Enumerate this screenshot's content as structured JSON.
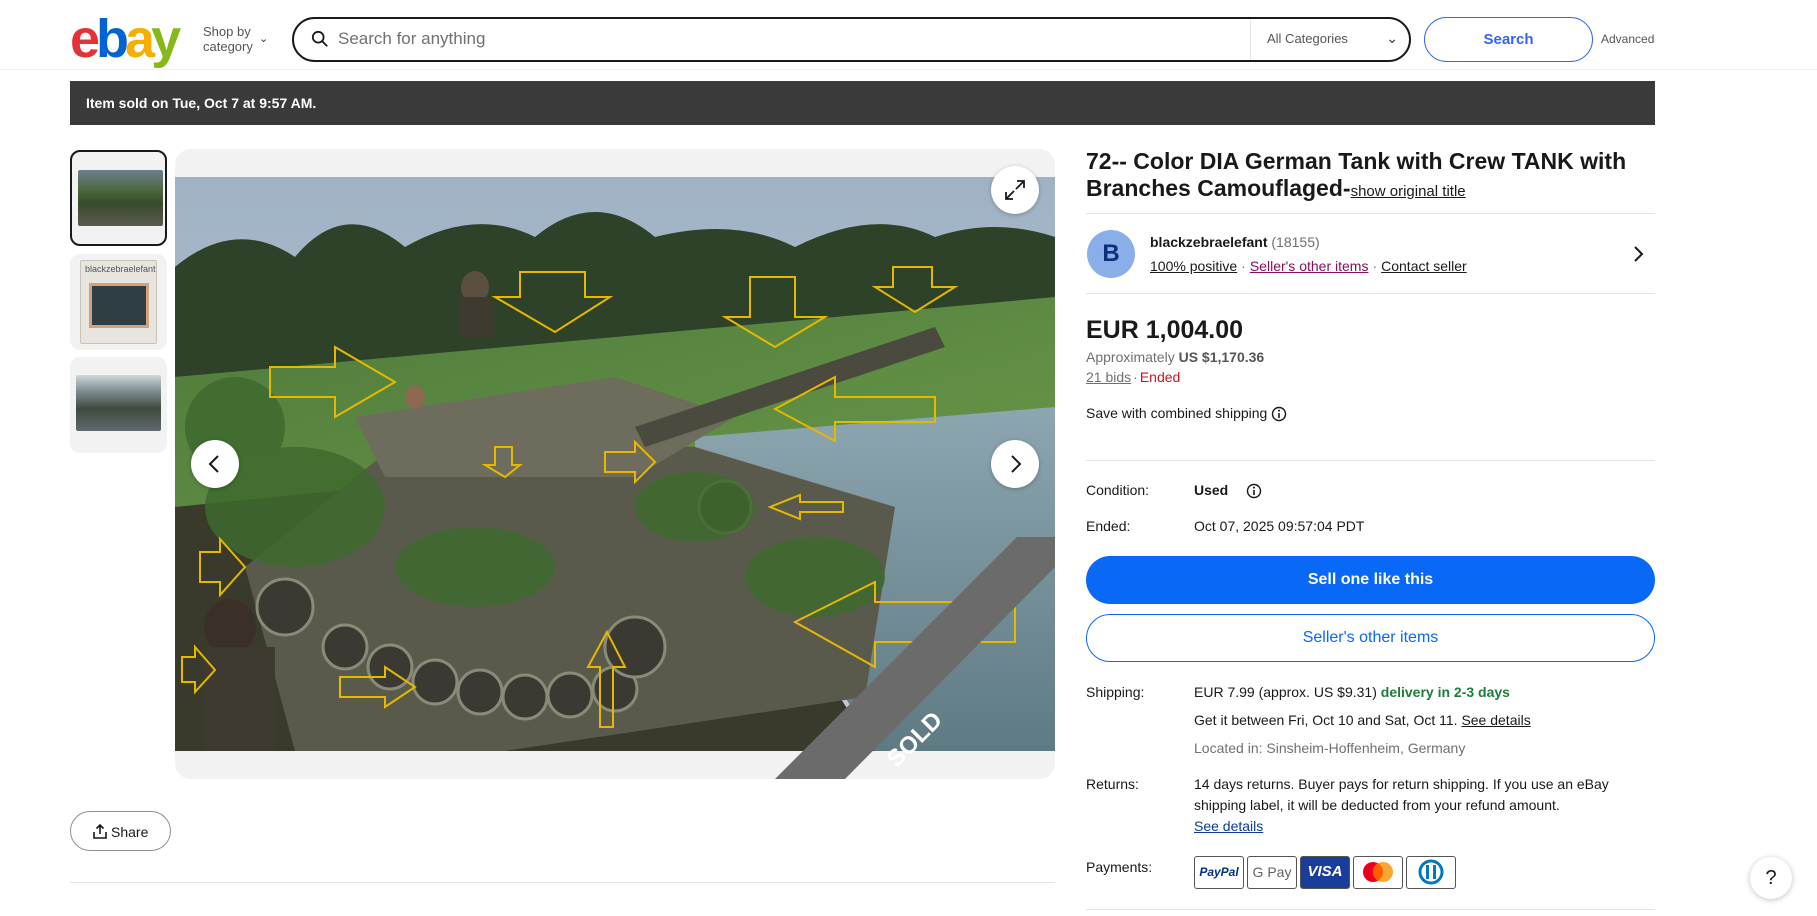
{
  "header": {
    "logo_letters": [
      "e",
      "b",
      "a",
      "y"
    ],
    "logo_colors": [
      "#e53238",
      "#0064d2",
      "#f5af02",
      "#86b817"
    ],
    "shop_by_line1": "Shop by",
    "shop_by_line2": "category",
    "search_placeholder": "Search for anything",
    "category_selected": "All Categories",
    "search_button": "Search",
    "advanced_link": "Advanced"
  },
  "banner": {
    "text": "Item sold on Tue, Oct 7 at 9:57 AM."
  },
  "gallery": {
    "thumb2_label": "blackzebraelefant",
    "sold_ribbon": "SOLD",
    "share_label": "Share"
  },
  "listing": {
    "title": "72-- Color DIA German Tank with Crew TANK with Branches Camouflaged-",
    "show_original_title": "show original title",
    "seller": {
      "initial": "B",
      "name": "blackzebraelefant",
      "feedback_count": "(18155)",
      "positive": "100% positive",
      "other_items_link": "Seller's other items",
      "contact_link": "Contact seller",
      "separator": "·"
    },
    "price": "EUR 1,004.00",
    "approx_label": "Approximately",
    "approx_value": "US $1,170.36",
    "bids": "21 bids",
    "bids_separator": "·",
    "status": "Ended",
    "combined_shipping": "Save with combined shipping",
    "condition_label": "Condition:",
    "condition_value": "Used",
    "ended_label": "Ended:",
    "ended_value": "Oct 07, 2025 09:57:04 PDT",
    "sell_button": "Sell one like this",
    "other_items_button": "Seller's other items",
    "shipping_label": "Shipping:",
    "shipping_cost": "EUR 7.99 (approx. US $9.31)",
    "shipping_delivery": "delivery in 2-3 days",
    "shipping_dates": "Get it between Fri, Oct 10 and Sat, Oct 11.",
    "see_details": "See details",
    "location": "Located in: Sinsheim-Hoffenheim, Germany",
    "returns_label": "Returns:",
    "returns_text_1": "14 days returns. Buyer pays for return shipping. If you use an eBay",
    "returns_text_2": "shipping label, it will be deducted from your refund amount.",
    "returns_see_details": "See details",
    "payments_label": "Payments:",
    "payment_methods": [
      "PayPal",
      "G Pay",
      "VISA",
      "Mastercard",
      "Diners Club"
    ]
  },
  "help_label": "?",
  "icons": {
    "search": "search-icon",
    "chevron_down": "chevron-down-icon",
    "expand": "expand-icon",
    "prev": "chevron-left-icon",
    "next": "chevron-right-icon",
    "share": "share-icon",
    "info": "info-icon",
    "chevron_right": "chevron-right-icon"
  },
  "colors": {
    "primary_blue": "#0968f6",
    "search_blue": "#3665f3",
    "ended_red": "#c4181f",
    "delivery_green": "#1d7d3a",
    "banner_bg": "#3a3a3a"
  }
}
